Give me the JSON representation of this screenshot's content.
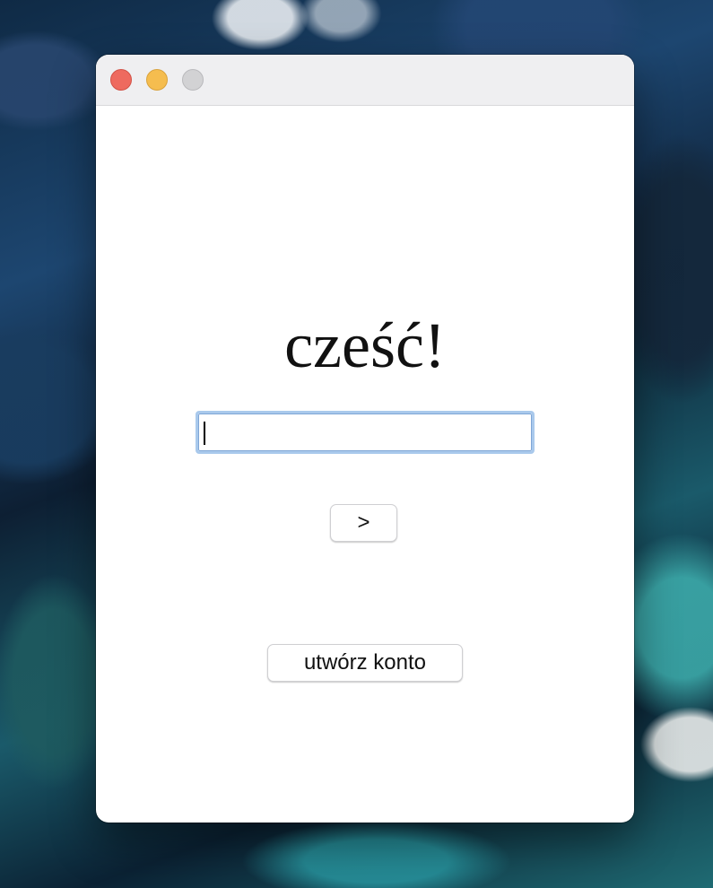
{
  "window": {
    "controls": {
      "close": "close",
      "minimize": "minimize",
      "zoom": "zoom"
    },
    "colors": {
      "close": "#ee6a5f",
      "minimize": "#f5bd4f",
      "zoom": "#d2d2d4",
      "focus_ring": "#a9c9ec"
    }
  },
  "login": {
    "greeting": "cześć!",
    "field_value": "",
    "next_label": ">",
    "create_account_label": "utwórz konto"
  }
}
